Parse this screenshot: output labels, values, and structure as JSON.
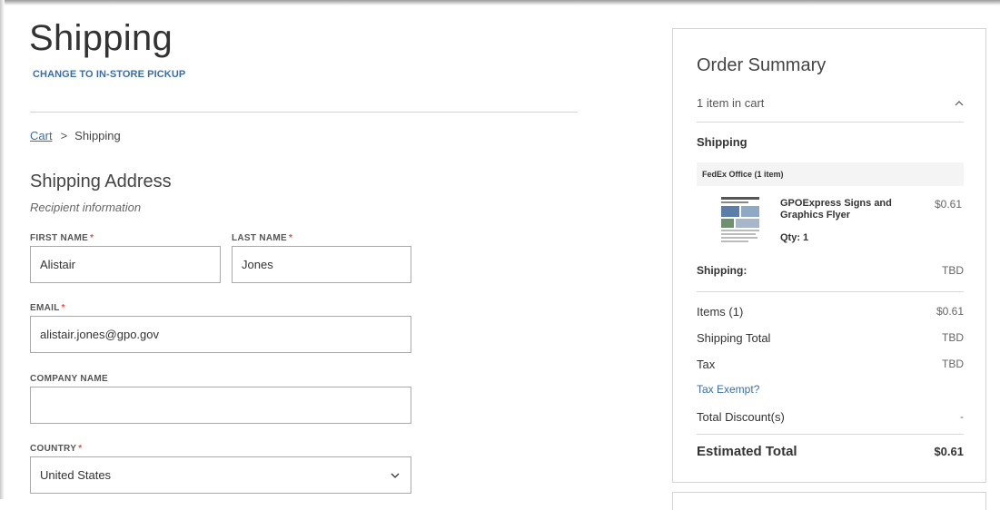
{
  "page": {
    "title": "Shipping",
    "pickup_link": "CHANGE TO IN-STORE PICKUP"
  },
  "breadcrumb": {
    "cart": "Cart",
    "separator": ">",
    "current": "Shipping"
  },
  "address": {
    "title": "Shipping Address",
    "subtitle": "Recipient information",
    "required_mark": "*",
    "fields": {
      "first_name": {
        "label": "FIRST NAME",
        "value": "Alistair",
        "required": true
      },
      "last_name": {
        "label": "LAST NAME",
        "value": "Jones",
        "required": true
      },
      "email": {
        "label": "EMAIL",
        "value": "alistair.jones@gpo.gov",
        "required": true
      },
      "company": {
        "label": "COMPANY NAME",
        "value": "",
        "required": false
      },
      "country": {
        "label": "COUNTRY",
        "value": "United States",
        "required": true
      }
    }
  },
  "summary": {
    "title": "Order Summary",
    "cart_count": "1 item in cart",
    "shipping_heading": "Shipping",
    "vendor": "FedEx Office (1 item)",
    "item": {
      "name": "GPOExpress Signs and Graphics Flyer",
      "price": "$0.61",
      "qty": "Qty: 1"
    },
    "shipping": {
      "label": "Shipping:",
      "value": "TBD"
    },
    "lines": {
      "items": {
        "label": "Items (1)",
        "value": "$0.61"
      },
      "shipping_total": {
        "label": "Shipping Total",
        "value": "TBD"
      },
      "tax": {
        "label": "Tax",
        "value": "TBD"
      },
      "tax_exempt": "Tax Exempt?",
      "discount": {
        "label": "Total Discount(s)",
        "value": "-"
      }
    },
    "total": {
      "label": "Estimated Total",
      "value": "$0.61"
    }
  },
  "colors": {
    "link": "#3a6ea5",
    "required": "#d9534f",
    "border": "#a9a9a9"
  }
}
